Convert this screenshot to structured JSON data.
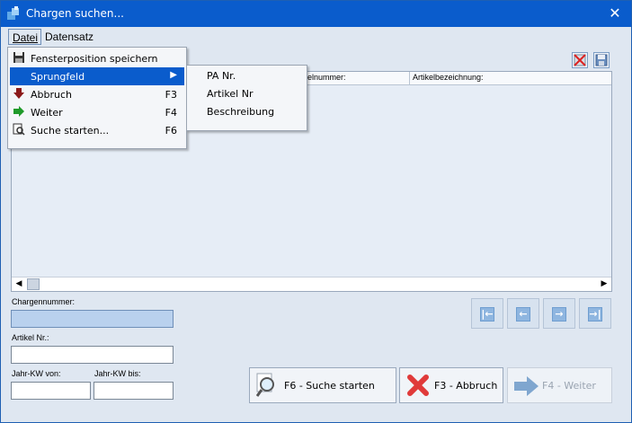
{
  "window": {
    "title": "Chargen suchen...",
    "close_glyph": "✕"
  },
  "menubar": {
    "items": [
      {
        "label": "Datei"
      },
      {
        "label": "Datensatz"
      }
    ]
  },
  "grid": {
    "columns": [
      {
        "label": "elnummer:"
      },
      {
        "label": "Artikelbezeichnung:"
      }
    ]
  },
  "form": {
    "chargennummer_label": "Chargennummer:",
    "chargennummer_value": "",
    "artikel_label": "Artikel Nr.:",
    "artikel_value": "",
    "jahr_von_label": "Jahr-KW von:",
    "jahr_von_value": "",
    "jahr_bis_label": "Jahr-KW bis:",
    "jahr_bis_value": ""
  },
  "nav": {
    "first_icon": "first-record-icon",
    "prev_icon": "previous-record-icon",
    "next_icon": "next-record-icon",
    "last_icon": "last-record-icon"
  },
  "actions": {
    "search": {
      "label": "F6 - Suche starten"
    },
    "cancel": {
      "label": "F3 - Abbruch"
    },
    "next": {
      "label": "F4 - Weiter"
    }
  },
  "datei_menu": {
    "items": [
      {
        "label": "Fensterposition speichern",
        "shortcut": "",
        "icon": "floppy-disk-icon"
      },
      {
        "label": "Sprungfeld",
        "shortcut": "",
        "icon": "",
        "submenu_arrow": "▶"
      },
      {
        "label": "Abbruch",
        "shortcut": "F3",
        "icon": "red-arrow-down-icon"
      },
      {
        "label": "Weiter",
        "shortcut": "F4",
        "icon": "green-arrow-right-icon"
      },
      {
        "label": "Suche starten...",
        "shortcut": "F6",
        "icon": "search-document-icon"
      }
    ]
  },
  "sprungfeld_submenu": {
    "items": [
      {
        "label": "PA Nr."
      },
      {
        "label": "Artikel Nr"
      },
      {
        "label": "Beschreibung"
      }
    ]
  },
  "colors": {
    "titlebar": "#0a5ccc",
    "window_bg": "#dfe7f1",
    "highlight": "#0a5ccc",
    "active_field": "#b9d1ee"
  }
}
